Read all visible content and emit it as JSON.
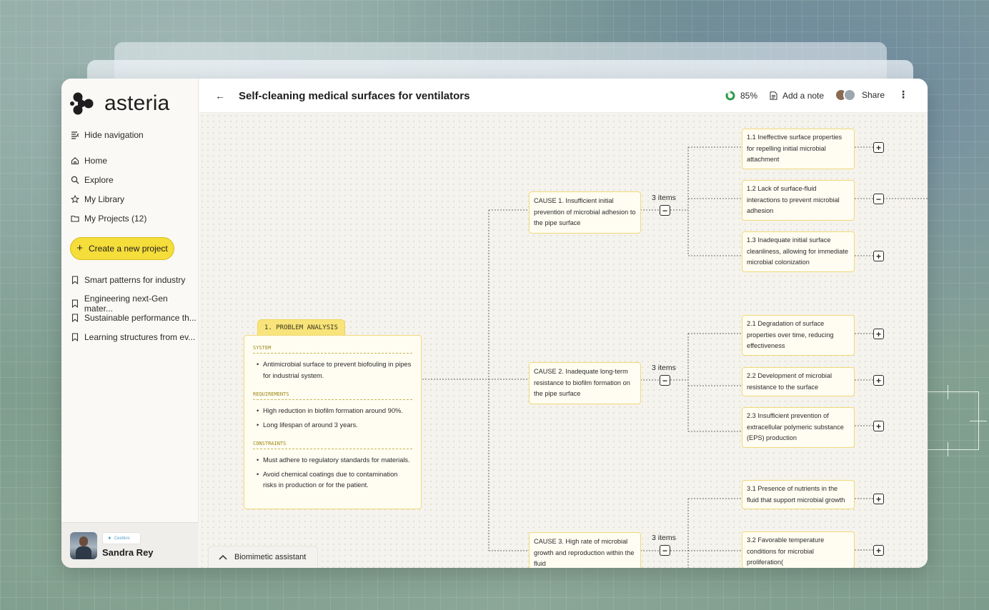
{
  "app": {
    "name": "asteria",
    "colors": {
      "accent": "#f5dd3a",
      "card_border": "#efd97a",
      "card_bg": "#fffdf2"
    }
  },
  "sidebar": {
    "hide_nav_label": "Hide navigation",
    "nav": [
      {
        "label": "Home",
        "icon": "home-icon"
      },
      {
        "label": "Explore",
        "icon": "search-icon"
      },
      {
        "label": "My Library",
        "icon": "star-icon"
      },
      {
        "label": "My Projects (12)",
        "icon": "folder-icon"
      }
    ],
    "cta_label": "Create a new project",
    "projects": [
      "Smart patterns for industry",
      "Engineering next-Gen mater...",
      "Sustainable performance th...",
      "Learning structures from ev..."
    ],
    "user": {
      "name": "Sandra Rey",
      "org": "Ceebios"
    }
  },
  "header": {
    "title": "Self-cleaning medical surfaces for ventilators",
    "progress": "85%",
    "progress_value": 0.85,
    "add_note": "Add a note",
    "share": "Share"
  },
  "problem": {
    "tab": "1. PROBLEM ANALYSIS",
    "system_title": "SYSTEM",
    "system_items": [
      "Antimicrobial surface to prevent biofouling in pipes for industrial system."
    ],
    "requirements_title": "REQUIREMENTS",
    "requirements_items": [
      "High reduction in biofilm formation around 90%.",
      "Long lifespan of around 3 years."
    ],
    "constraints_title": "CONSTRAINTS",
    "constraints_items": [
      "Must adhere to regulatory standards for materials.",
      "Avoid chemical coatings due to contamination risks in production or for the patient."
    ]
  },
  "causes": [
    {
      "text": "CAUSE 1. Insufficient initial prevention of microbial adhesion to the pipe surface",
      "items": "3 items"
    },
    {
      "text": "CAUSE 2. Inadequate long-term resistance to biofilm formation on the pipe surface",
      "items": "3 items"
    },
    {
      "text": "CAUSE 3. High rate of microbial growth and reproduction within the fluid",
      "items": "3 items"
    }
  ],
  "leaves": [
    {
      "text": "1.1 Ineffective surface properties for repelling initial microbial attachment",
      "state": "+"
    },
    {
      "text": "1.2 Lack of surface-fluid interactions to prevent microbial adhesion",
      "state": "−"
    },
    {
      "text": "1.3 Inadequate initial surface cleanliness, allowing for immediate microbial colonization",
      "state": "+"
    },
    {
      "text": "2.1 Degradation of surface properties over time, reducing effectiveness",
      "state": "+"
    },
    {
      "text": "2.2 Development of microbial resistance to the surface",
      "state": "+"
    },
    {
      "text": "2.3 Insufficient prevention of extracellular polymeric substance (EPS) production",
      "state": "+"
    },
    {
      "text": "3.1 Presence of nutrients in the fluid that support microbial growth",
      "state": "+"
    },
    {
      "text": "3.2 Favorable temperature conditions for microbial proliferation(",
      "state": "+"
    }
  ],
  "cause_toggle": "−",
  "assistant_label": "Biomimetic assistant"
}
